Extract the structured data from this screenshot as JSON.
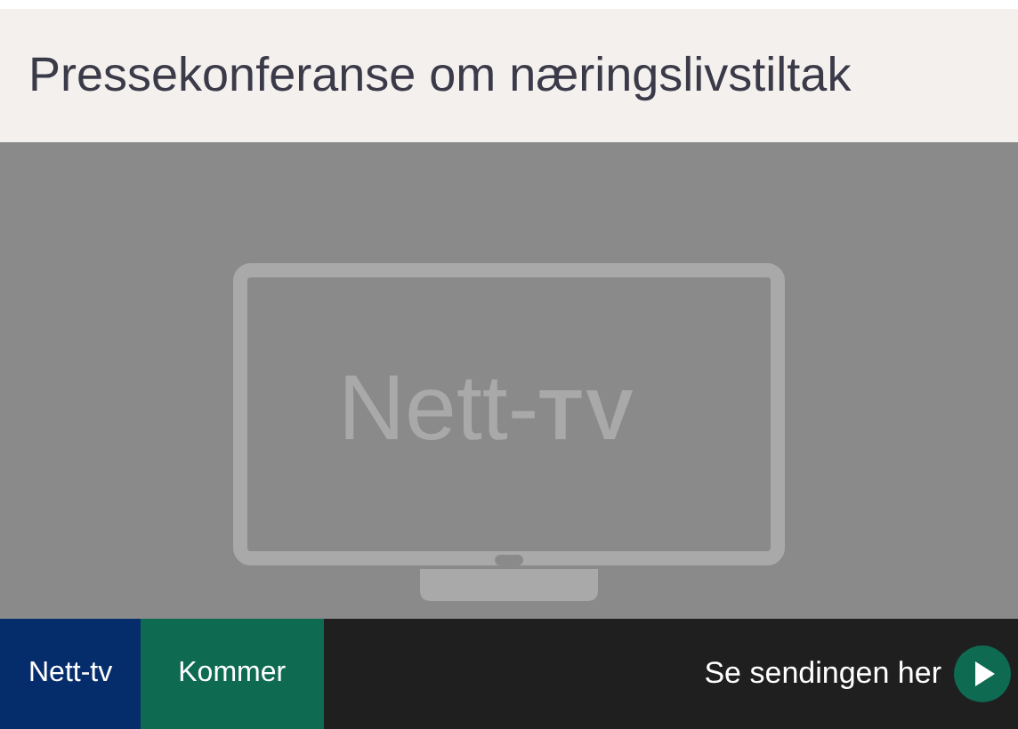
{
  "title": "Pressekonferanse om næringslivstiltak",
  "player": {
    "logo_text": "Nett-",
    "logo_bold": "TV"
  },
  "bottom_bar": {
    "tags": [
      {
        "label": "Nett-tv",
        "color": "#062d6b"
      },
      {
        "label": "Kommer",
        "color": "#0f6a52"
      }
    ],
    "watch_link": "Se sendingen her"
  }
}
